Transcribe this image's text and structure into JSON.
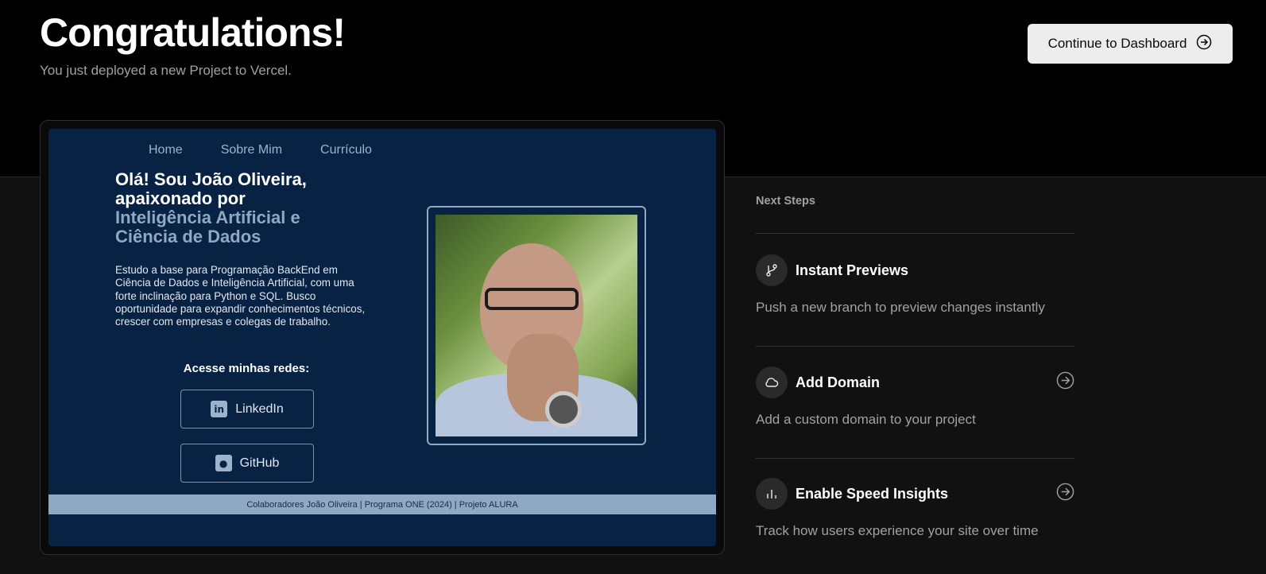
{
  "header": {
    "title": "Congratulations!",
    "subtitle": "You just deployed a new Project to Vercel.",
    "dashboard_button": "Continue to Dashboard"
  },
  "preview": {
    "nav": [
      "Home",
      "Sobre Mim",
      "Currículo"
    ],
    "heading_line1": "Olá! Sou João Oliveira,",
    "heading_line2": "apaixonado por",
    "heading_accent": "Inteligência Artificial e Ciência de Dados",
    "body": "Estudo a base para Programação BackEnd em Ciência de Dados e Inteligência Artificial, com uma forte inclinação para Python e SQL. Busco oportunidade para expandir conhecimentos técnicos, crescer com empresas e colegas de trabalho.",
    "social_heading": "Acesse minhas redes:",
    "linkedin_label": "LinkedIn",
    "github_label": "GitHub",
    "footer": "Colaboradores João Oliveira | Programa ONE (2024) | Projeto ALURA"
  },
  "next_steps": {
    "title": "Next Steps",
    "items": [
      {
        "label": "Instant Previews",
        "description": "Push a new branch to preview changes instantly",
        "icon": "git-branch-icon"
      },
      {
        "label": "Add Domain",
        "description": "Add a custom domain to your project",
        "icon": "cloud-icon"
      },
      {
        "label": "Enable Speed Insights",
        "description": "Track how users experience your site over time",
        "icon": "bar-chart-icon"
      }
    ]
  },
  "colors": {
    "accent_site": "#082244",
    "site_footer": "#8fa8c4",
    "button_bg": "#ededed"
  }
}
